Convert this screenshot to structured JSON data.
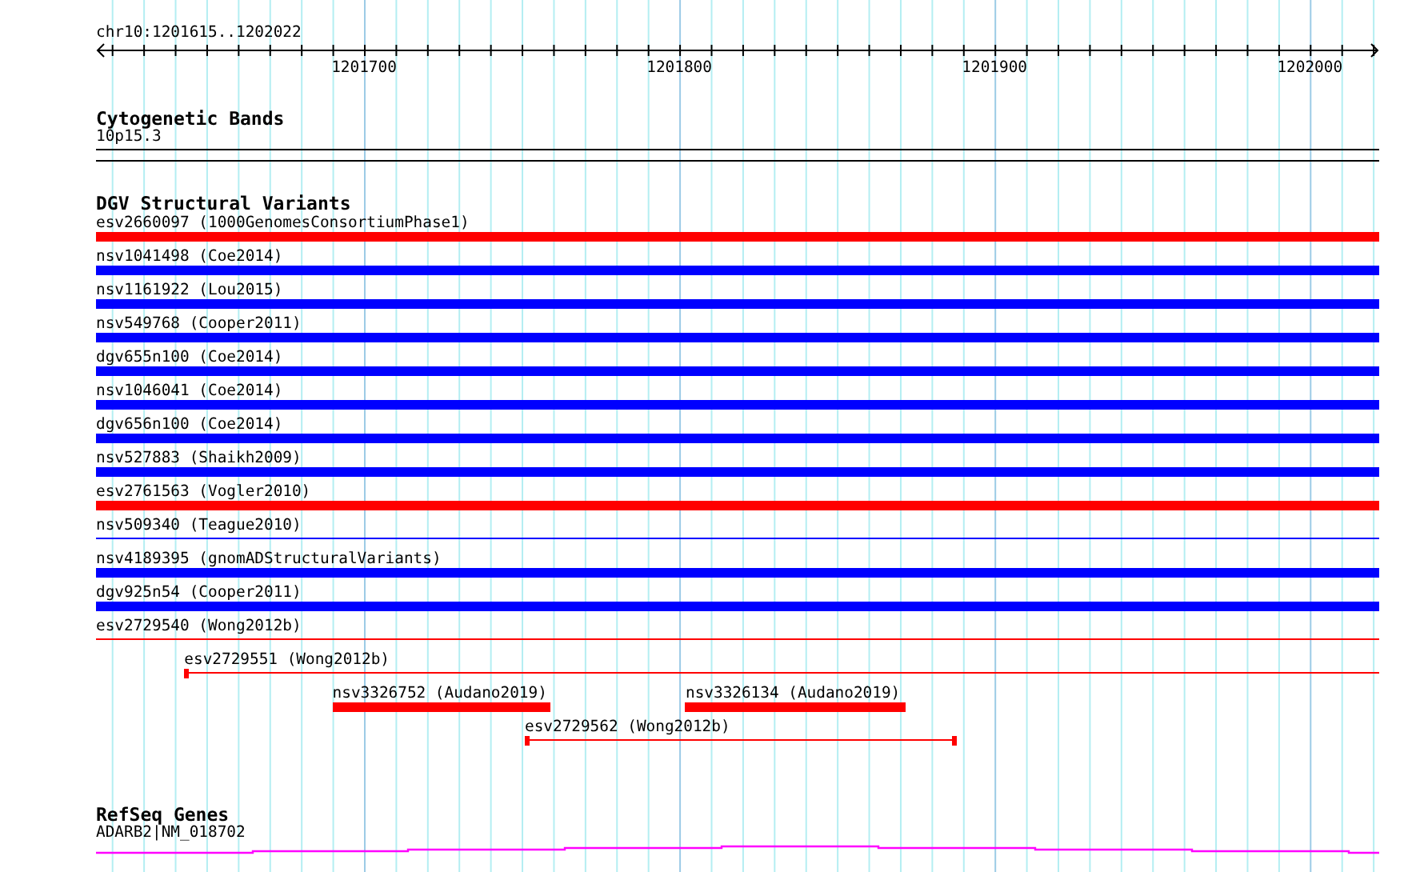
{
  "location": "chr10:1201615..1202022",
  "ruler_ticks": [
    {
      "label": "1201700"
    },
    {
      "label": "1201800"
    },
    {
      "label": "1201900"
    },
    {
      "label": "1202000"
    }
  ],
  "cytogenetic_bands": {
    "title": "Cytogenetic Bands",
    "band": "10p15.3"
  },
  "dgv": {
    "title": "DGV Structural Variants",
    "rows": [
      [
        {
          "label": "esv2660097 (1000GenomesConsortiumPhase1)",
          "kind": "bar",
          "color": "#ff0000"
        }
      ],
      [
        {
          "label": "nsv1041498 (Coe2014)",
          "kind": "bar",
          "color": "#0000ff"
        }
      ],
      [
        {
          "label": "nsv1161922 (Lou2015)",
          "kind": "bar",
          "color": "#0000ff"
        }
      ],
      [
        {
          "label": "nsv549768 (Cooper2011)",
          "kind": "bar",
          "color": "#0000ff"
        }
      ],
      [
        {
          "label": "dgv655n100 (Coe2014)",
          "kind": "bar",
          "color": "#0000ff"
        }
      ],
      [
        {
          "label": "nsv1046041 (Coe2014)",
          "kind": "bar",
          "color": "#0000ff"
        }
      ],
      [
        {
          "label": "dgv656n100 (Coe2014)",
          "kind": "bar",
          "color": "#0000ff"
        }
      ],
      [
        {
          "label": "nsv527883 (Shaikh2009)",
          "kind": "bar",
          "color": "#0000ff"
        }
      ],
      [
        {
          "label": "esv2761563 (Vogler2010)",
          "kind": "bar",
          "color": "#ff0000"
        }
      ],
      [
        {
          "label": "nsv509340 (Teague2010)",
          "kind": "line",
          "color": "#0000ff"
        }
      ],
      [
        {
          "label": "nsv4189395 (gnomADStructuralVariants)",
          "kind": "bar",
          "color": "#0000ff"
        }
      ],
      [
        {
          "label": "dgv925n54 (Cooper2011)",
          "kind": "bar",
          "color": "#0000ff"
        }
      ],
      [
        {
          "label": "esv2729540 (Wong2012b)",
          "kind": "line",
          "color": "#ff0000"
        }
      ],
      [
        {
          "label": "esv2729551 (Wong2012b)",
          "kind": "line",
          "color": "#ff0000"
        }
      ],
      [
        {
          "label": "nsv3326752 (Audano2019)",
          "kind": "bar",
          "color": "#ff0000"
        },
        {
          "label": "nsv3326134 (Audano2019)",
          "kind": "bar",
          "color": "#ff0000"
        }
      ],
      [
        {
          "label": "esv2729562 (Wong2012b)",
          "kind": "line",
          "color": "#ff0000"
        }
      ]
    ]
  },
  "refseq": {
    "title": "RefSeq Genes",
    "gene": "ADARB2|NM_018702"
  }
}
